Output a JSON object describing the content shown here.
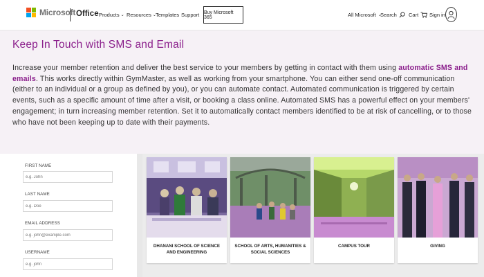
{
  "header": {
    "brand": "Microsoft",
    "product": "Office",
    "nav": [
      {
        "label": "Products",
        "has_menu": true
      },
      {
        "label": "Resources",
        "has_menu": true
      },
      {
        "label": "Templates",
        "has_menu": false
      },
      {
        "label": "Support",
        "has_menu": false
      }
    ],
    "buy_label": "Buy Microsoft 365",
    "all_microsoft": "All Microsoft",
    "search_label": "Search",
    "cart_label": "Cart",
    "signin_label": "Sign in",
    "logo_colors": [
      "#f25022",
      "#7fba00",
      "#00a4ef",
      "#ffb900"
    ]
  },
  "intro": {
    "title": "Keep In Touch with SMS and Email",
    "text_before": "Increase your member retention and deliver the best service to your members by getting in contact with them using ",
    "highlight": "automatic SMS and emails",
    "text_after": ". This works directly within GymMaster, as well as working from your smartphone. You can either send one-off communication (either to an individual or a group as defined by you), or you can automate contact. Automated communication is triggered by certain events, such as a specific amount of time after a visit, or booking a class online. Automated SMS has a powerful effect on your members' engagement; in turn increasing member retention. Set it to automatically contact members identified to be at risk of cancelling, or to those who have not been keeping up to date with their payments.",
    "accent_color": "#8a1e8b"
  },
  "form": {
    "fields": [
      {
        "label": "FIRST NAME",
        "placeholder": "e.g. John"
      },
      {
        "label": "LAST NAME",
        "placeholder": "e.g. Doe"
      },
      {
        "label": "EMAIL ADDRESS",
        "placeholder": "e.g. john@example.com"
      },
      {
        "label": "USERNAME",
        "placeholder": "e.g. john"
      }
    ]
  },
  "cards": [
    {
      "caption": "DHANANI SCHOOL OF SCIENCE AND ENGINEERING"
    },
    {
      "caption": "SCHOOL OF ARTS, HUMANITIES & SOCIAL SCIENCES"
    },
    {
      "caption": "CAMPUS TOUR"
    },
    {
      "caption": "GIVING"
    }
  ]
}
